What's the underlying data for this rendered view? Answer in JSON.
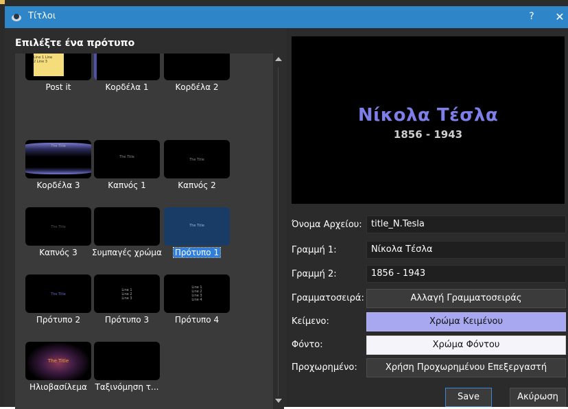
{
  "window": {
    "title": "Τίτλοι",
    "help": "?",
    "close": "✕"
  },
  "left": {
    "heading": "Επιλέξτε ένα πρότυπο"
  },
  "templates": [
    {
      "label": "Post it",
      "thumb_text": "Line 1 Line 2 Line 3"
    },
    {
      "label": "Κορδέλα 1",
      "thumb_text": ""
    },
    {
      "label": "Κορδέλα 2",
      "thumb_text": ""
    },
    {
      "label": "Κορδέλα 3",
      "thumb_text": "The Title"
    },
    {
      "label": "Καπνός 1",
      "thumb_text": "The Title"
    },
    {
      "label": "Καπνός 2",
      "thumb_text": "The Title"
    },
    {
      "label": "Καπνός 3",
      "thumb_text": "The Title"
    },
    {
      "label": "Συμπαγές χρώμα",
      "thumb_text": ""
    },
    {
      "label": "Πρότυπο 1",
      "thumb_text": "The Title",
      "selected": true
    },
    {
      "label": "Πρότυπο 2",
      "thumb_text": "The Title"
    },
    {
      "label": "Πρότυπο 3",
      "thumb_text": "Line 1 Line 2 Line 3"
    },
    {
      "label": "Πρότυπο 4",
      "thumb_text": "Line 1 Line 2 Line 3 Line 4"
    },
    {
      "label": "Ηλιοβασίλεμα",
      "thumb_text": "The Title"
    },
    {
      "label": "Ταξινόμηση τ...",
      "thumb_text": ""
    }
  ],
  "preview": {
    "title": "Νίκολα Τέσλα",
    "subtitle": "1856 - 1943",
    "title_color": "#7e7ee8"
  },
  "form": {
    "filename_label": "Όνομα Αρχείου:",
    "filename_value": "title_N.Tesla",
    "line1_label": "Γραμμή 1:",
    "line1_value": "Νίκολα Τέσλα",
    "line2_label": "Γραμμή 2:",
    "line2_value": "1856 - 1943",
    "font_label": "Γραμματοσειρά:",
    "font_button": "Αλλαγή Γραμματοσειράς",
    "text_label": "Κείμενο:",
    "text_button": "Χρώμα Κειμένου",
    "bg_label": "Φόντο:",
    "bg_button": "Χρώμα Φόντου",
    "advanced_label": "Προχωρημένο:",
    "advanced_button": "Χρήση Προχωρημένου Επεξεργαστή"
  },
  "footer": {
    "save": "Save",
    "cancel": "Ακύρωση"
  },
  "colors": {
    "accent": "#2e86c8",
    "selection": "#2f7fe0",
    "text_color_swatch": "#a8a8f0",
    "bg_color_swatch": "#f6f4fb"
  }
}
